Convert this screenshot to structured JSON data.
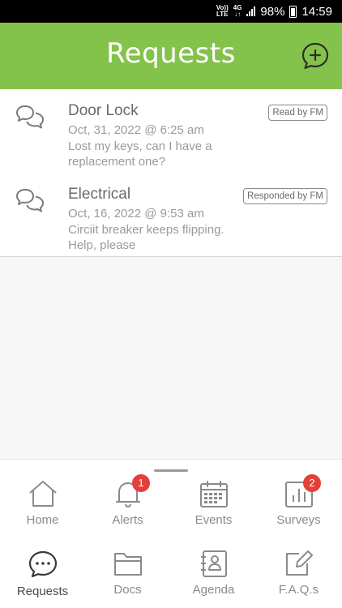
{
  "status_bar": {
    "carrier_top": "Vo))",
    "carrier_bottom": "LTE",
    "network_top": "4G",
    "network_bottom": "↓↑",
    "battery": "98%",
    "time": "14:59"
  },
  "header": {
    "title": "Requests"
  },
  "requests": [
    {
      "title": "Door Lock",
      "date": "Oct, 31, 2022 @ 6:25 am",
      "message": "Lost my keys, can I have a replacement one?",
      "status": "Read by FM"
    },
    {
      "title": "Electrical",
      "date": "Oct, 16, 2022 @ 9:53 am",
      "message": "Circiit breaker keeps flipping. Help, please",
      "status": "Responded by FM"
    }
  ],
  "nav": {
    "home": {
      "label": "Home",
      "icon": "home-icon"
    },
    "alerts": {
      "label": "Alerts",
      "icon": "bell-icon",
      "count": "1"
    },
    "events": {
      "label": "Events",
      "icon": "calendar-icon"
    },
    "surveys": {
      "label": "Surveys",
      "icon": "bar-chart-icon",
      "count": "2"
    },
    "requests": {
      "label": "Requests",
      "icon": "chat-bubble-icon"
    },
    "docs": {
      "label": "Docs",
      "icon": "folder-icon"
    },
    "agenda": {
      "label": "Agenda",
      "icon": "contacts-book-icon"
    },
    "faqs": {
      "label": "F.A.Q.s",
      "icon": "edit-note-icon"
    }
  },
  "colors": {
    "header_green": "#84c34b",
    "badge_red": "#e3403a",
    "text_gray": "#9a9a9a"
  }
}
